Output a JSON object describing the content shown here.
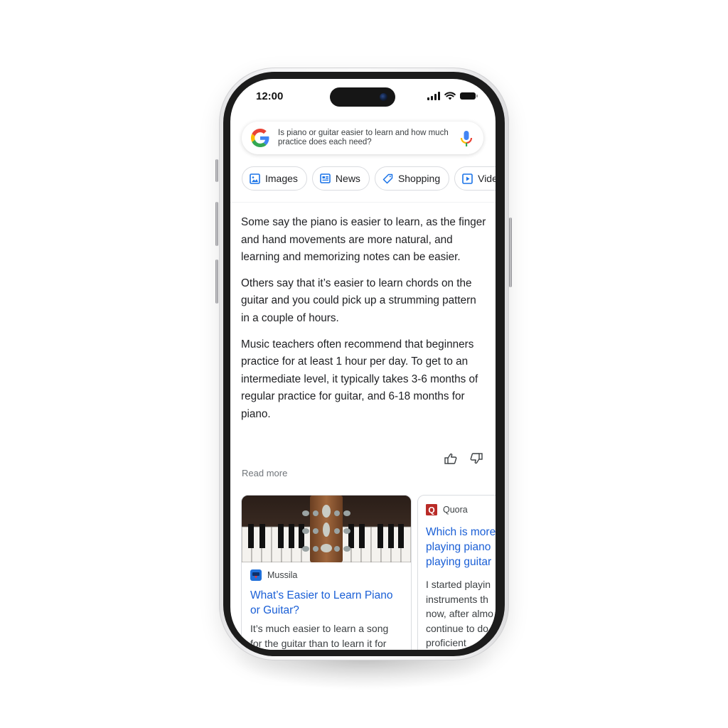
{
  "status_bar": {
    "time": "12:00",
    "icons": [
      "signal-icon",
      "wifi-icon",
      "battery-icon"
    ]
  },
  "search": {
    "logo": "google-g-logo",
    "query": "Is piano or guitar easier to learn and how much practice does each need?",
    "mic_icon": "microphone-icon"
  },
  "filters": [
    {
      "label": "Images",
      "icon": "image-icon"
    },
    {
      "label": "News",
      "icon": "news-icon"
    },
    {
      "label": "Shopping",
      "icon": "tag-icon"
    },
    {
      "label": "Videos",
      "icon": "play-icon",
      "visible_text": "Vide"
    }
  ],
  "answer": {
    "paragraphs": [
      "Some say the piano is easier to learn, as the finger and hand movements are more natural, and learning and memorizing notes can be easier.",
      "Others say that it’s easier to learn chords on the guitar and you could pick up a strumming pattern in a couple of hours.",
      "Music teachers often recommend that beginners practice for at least 1 hour per day. To get to an intermediate level, it typically takes 3-6 months of regular practice for guitar, and 6-18 months for piano."
    ],
    "feedback": {
      "thumbs_up": "thumbs-up-icon",
      "thumbs_down": "thumbs-down-icon"
    },
    "read_more": "Read more"
  },
  "sources": [
    {
      "source_name": "Mussila",
      "title": "What’s Easier to Learn Piano or Guitar?",
      "snippet": "It’s much easier to learn a song for the guitar than to learn it for",
      "image": "guitar headstock on piano keys"
    },
    {
      "source_name": "Quora",
      "title": "Which is more playing piano playing guitar",
      "snippet": "I started playin instruments th now, after almo continue to do proficient"
    }
  ],
  "colors": {
    "link_blue": "#1a5fd6",
    "text": "#202124",
    "muted": "#70757a",
    "quora_red": "#b92b27",
    "bezel": "#1c1c1c"
  }
}
